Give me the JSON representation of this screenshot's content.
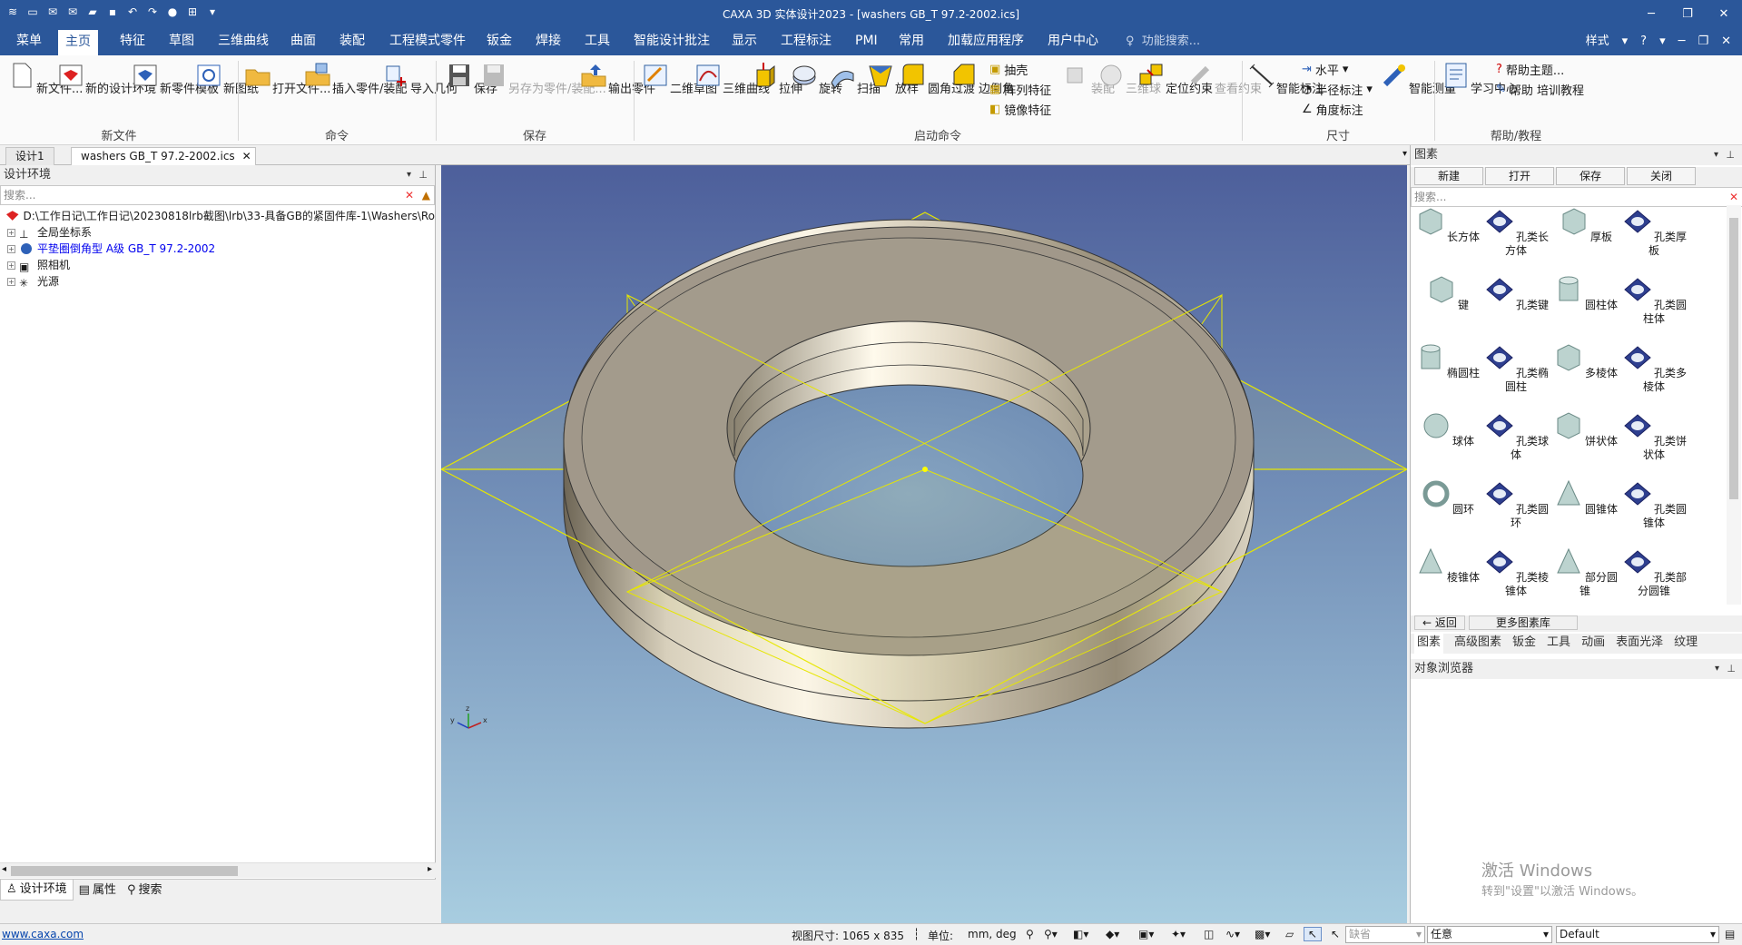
{
  "window": {
    "title": "CAXA 3D 实体设计2023 - [washers GB_T 97.2-2002.ics]"
  },
  "menu": {
    "tabs": [
      "菜单",
      "主页",
      "特征",
      "草图",
      "三维曲线",
      "曲面",
      "装配",
      "工程模式零件",
      "钣金",
      "焊接",
      "工具",
      "智能设计批注",
      "显示",
      "工程标注",
      "PMI",
      "常用",
      "加载应用程序",
      "用户中心"
    ],
    "search_placeholder": "功能搜索...",
    "style_label": "样式"
  },
  "ribbon": {
    "new_file": {
      "btn1": "新文件...",
      "btn2": "新的设计环境",
      "btn3": "新零件模板",
      "btn4": "新图纸",
      "group": "新文件"
    },
    "command": {
      "btn1": "打开文件...",
      "btn2": "插入零件/装配",
      "btn3": "导入几何",
      "group": "命令"
    },
    "save": {
      "btn1": "保存",
      "btn2": "另存为零件/装配...",
      "btn3": "输出零件",
      "group": "保存"
    },
    "launch": {
      "sketch2d": "二维草图",
      "curve3d": "三维曲线",
      "extrude": "拉伸",
      "revolve": "旋转",
      "sweep": "扫描",
      "loft": "放样",
      "fillet": "圆角过渡",
      "chamfer": "边倒角",
      "shell": "抽壳",
      "pattern": "阵列特征",
      "mirror": "镜像特征",
      "assemble": "装配",
      "ball3d": "三维球",
      "position": "定位约束",
      "view_constraint": "查看约束",
      "group": "启动命令"
    },
    "dimension": {
      "smart": "智能标注",
      "horizontal": "水平",
      "radius": "半径标注",
      "angle": "角度标注",
      "measure": "智能测量",
      "group": "尺寸"
    },
    "help": {
      "learn": "学习中心",
      "topic": "帮助主题...",
      "training": "帮助 培训教程",
      "group": "帮助/教程"
    }
  },
  "doc_tabs": [
    "设计1",
    "washers GB_T 97.2-2002.ics"
  ],
  "left_panel": {
    "title": "设计环境",
    "search_placeholder": "搜索...",
    "tree": {
      "root": "D:\\工作日记\\工作日记\\20230818lrb截图\\lrb\\33-具备GB的紧固件库-1\\Washers\\Ro",
      "coord": "全局坐标系",
      "part": "平垫圈倒角型 A级 GB_T 97.2-2002",
      "camera": "照相机",
      "light": "光源"
    },
    "tabs": [
      "设计环境",
      "属性",
      "搜索"
    ]
  },
  "right_panel": {
    "title": "图素",
    "buttons": [
      "新建",
      "打开",
      "保存",
      "关闭"
    ],
    "search_placeholder": "搜索...",
    "items": [
      "长方体",
      "孔类长方体",
      "厚板",
      "孔类厚板",
      "键",
      "孔类键",
      "圆柱体",
      "孔类圆柱体",
      "椭圆柱",
      "孔类椭圆柱",
      "多棱体",
      "孔类多棱体",
      "球体",
      "孔类球体",
      "饼状体",
      "孔类饼状体",
      "圆环",
      "孔类圆环",
      "圆锥体",
      "孔类圆锥体",
      "棱锥体",
      "孔类棱锥体",
      "部分圆锥",
      "孔类部分圆锥"
    ],
    "back": "返回",
    "more": "更多图素库",
    "tabs": [
      "图素",
      "高级图素",
      "钣金",
      "工具",
      "动画",
      "表面光泽",
      "纹理"
    ],
    "object_browser": "对象浏览器"
  },
  "watermark": {
    "line1": "激活 Windows",
    "line2": "转到\"设置\"以激活 Windows。"
  },
  "status": {
    "link": "www.caxa.com",
    "view_size": "视图尺寸: 1065 x  835",
    "unit_label": "单位:",
    "unit_value": "mm, deg",
    "combo1": "缺省",
    "combo2": "任意",
    "combo3": "Default"
  },
  "colors": {
    "title_bg": "#2b579a",
    "part_text": "#0000ee",
    "grid_yellow": "#e6e600"
  }
}
